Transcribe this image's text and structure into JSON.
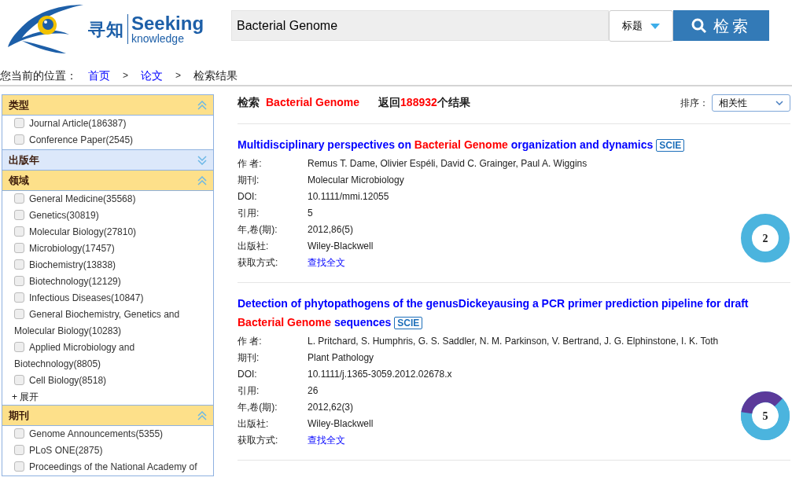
{
  "header": {
    "logo": {
      "chinese": "寻知",
      "english": "Seeking",
      "sub": "knowledge"
    },
    "search": {
      "value": "Bacterial Genome",
      "field": "标题",
      "button": "检索"
    }
  },
  "breadcrumb": {
    "label": "您当前的位置：",
    "items": [
      {
        "text": "首页",
        "link": true
      },
      {
        "text": "论文",
        "link": true
      },
      {
        "text": "检索结果",
        "link": false
      }
    ],
    "separator": ">"
  },
  "sidebar": [
    {
      "title": "类型",
      "expanded": true,
      "items": [
        {
          "label": "Journal Article(186387)",
          "checked": false
        },
        {
          "label": "Conference Paper(2545)",
          "checked": false
        }
      ]
    },
    {
      "title": "出版年",
      "expanded": false
    },
    {
      "title": "领域",
      "expanded": true,
      "items": [
        {
          "label": "General Medicine(35568)",
          "checked": false
        },
        {
          "label": "Genetics(30819)",
          "checked": false
        },
        {
          "label": "Molecular Biology(27810)",
          "checked": false
        },
        {
          "label": "Microbiology(17457)",
          "checked": false
        },
        {
          "label": "Biochemistry(13838)",
          "checked": false
        },
        {
          "label": "Biotechnology(12129)",
          "checked": false
        },
        {
          "label": "Infectious Diseases(10847)",
          "checked": false
        },
        {
          "label": "General Biochemistry, Genetics and Molecular Biology(10283)",
          "checked": false
        },
        {
          "label": "Applied Microbiology and Biotechnology(8805)",
          "checked": false
        },
        {
          "label": "Cell Biology(8518)",
          "checked": false
        }
      ],
      "more": "+ 展开"
    },
    {
      "title": "期刊",
      "expanded": true,
      "items": [
        {
          "label": "Genome Announcements(5355)",
          "checked": false
        },
        {
          "label": "PLoS ONE(2875)",
          "checked": false
        },
        {
          "label": "Proceedings of the National Academy of",
          "checked": false
        }
      ]
    }
  ],
  "summary": {
    "label": "检索",
    "query": "Bacterial Genome",
    "before": "返回",
    "count": "188932",
    "after": "个结果"
  },
  "sort": {
    "label": "排序：",
    "value": "相关性"
  },
  "results": [
    {
      "title": [
        {
          "text": "Multidisciplinary perspectives on ",
          "highlight": false
        },
        {
          "text": "Bacterial Genome",
          "highlight": true
        },
        {
          "text": " organization and dynamics",
          "highlight": false
        }
      ],
      "badge": "SCIE",
      "fields": [
        {
          "label": "作 者:",
          "value": "Remus T. Dame, Olivier Espéli, David C. Grainger, Paul A. Wiggins",
          "link": false
        },
        {
          "label": "期刊:",
          "value": "Molecular Microbiology",
          "link": false
        },
        {
          "label": "DOI:",
          "value": "10.1111/mmi.12055",
          "link": false
        },
        {
          "label": "引用:",
          "value": "5",
          "link": false
        },
        {
          "label": "年,卷(期):",
          "value": "2012,86(5)",
          "link": false
        },
        {
          "label": "出版社:",
          "value": "Wiley-Blackwell",
          "link": false
        },
        {
          "label": "获取方式:",
          "value": "查找全文",
          "link": true
        }
      ],
      "score": {
        "value": "2",
        "rings": [
          {
            "color": "#4bb4de"
          }
        ]
      }
    },
    {
      "title": [
        {
          "text": "Detection of phytopathogens of the genusDickeyausing a PCR primer prediction pipeline for draft ",
          "highlight": false
        },
        {
          "text": "Bacterial Genome",
          "highlight": true
        },
        {
          "text": " sequences",
          "highlight": false
        }
      ],
      "badge": "SCIE",
      "fields": [
        {
          "label": "作 者:",
          "value": "L. Pritchard, S. Humphris, G. S. Saddler, N. M. Parkinson, V. Bertrand, J. G. Elphinstone, I. K. Toth",
          "link": false
        },
        {
          "label": "期刊:",
          "value": "Plant Pathology",
          "link": false
        },
        {
          "label": "DOI:",
          "value": "10.1111/j.1365-3059.2012.02678.x",
          "link": false
        },
        {
          "label": "引用:",
          "value": "26",
          "link": false
        },
        {
          "label": "年,卷(期):",
          "value": "2012,62(3)",
          "link": false
        },
        {
          "label": "出版社:",
          "value": "Wiley-Blackwell",
          "link": false
        },
        {
          "label": "获取方式:",
          "value": "查找全文",
          "link": true
        }
      ],
      "score": {
        "value": "5",
        "rings": [
          {
            "color": "#4bb4de"
          },
          {
            "color": "#5b3a9a"
          }
        ]
      }
    }
  ]
}
